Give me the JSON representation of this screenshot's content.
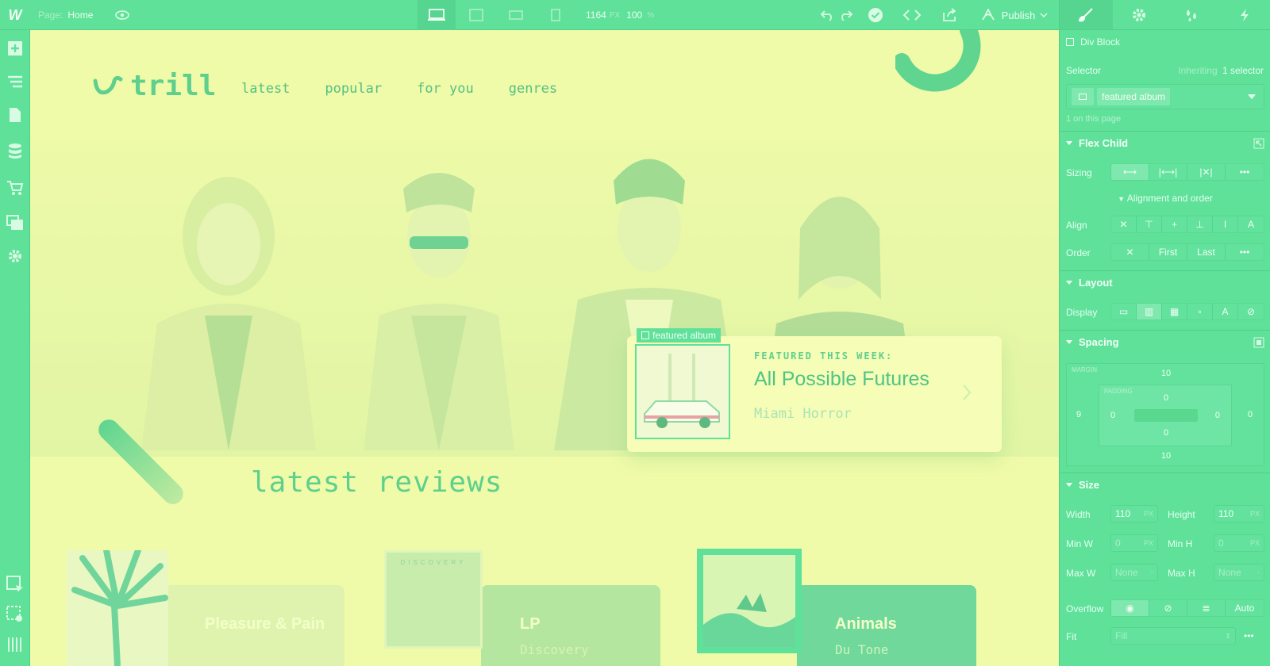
{
  "topbar": {
    "logo": "W",
    "page_label": "Page:",
    "page_name": "Home",
    "width_value": "1164",
    "width_unit": "PX",
    "zoom_value": "100",
    "zoom_unit": "%",
    "publish_label": "Publish"
  },
  "site": {
    "brand": "trill",
    "nav": [
      "latest",
      "popular",
      "for you",
      "genres"
    ],
    "featured_tag": "featured album",
    "featured_kicker": "FEATURED THIS WEEK:",
    "featured_title": "All Possible Futures",
    "featured_artist": "Miami Horror",
    "reviews_title": "latest reviews",
    "cards": [
      {
        "title": "Pleasure & Pain"
      },
      {
        "title": "LP",
        "subtitle": "Discovery",
        "cover_text": "DISCOVERY"
      },
      {
        "title": "Animals",
        "subtitle": "Du Tone"
      }
    ]
  },
  "panel": {
    "element_name": "Div Block",
    "selector_label": "Selector",
    "inheriting_label": "Inheriting",
    "inheriting_count": "1 selector",
    "selector_value": "featured album",
    "on_page_text": "1 on this page",
    "flex_child_title": "Flex Child",
    "sizing_label": "Sizing",
    "alignment_order_label": "Alignment and order",
    "align_label": "Align",
    "order_label": "Order",
    "order_first": "First",
    "order_last": "Last",
    "layout_title": "Layout",
    "display_label": "Display",
    "spacing_title": "Spacing",
    "margin_label": "MARGIN",
    "padding_label": "PADDING",
    "margin_top": "10",
    "margin_bottom": "10",
    "margin_left": "9",
    "margin_right": "0",
    "padding_top": "0",
    "padding_bottom": "0",
    "padding_left": "0",
    "padding_right": "0",
    "size_title": "Size",
    "width_label": "Width",
    "width_value": "110",
    "height_label": "Height",
    "height_value": "110",
    "unit_px": "PX",
    "minw_label": "Min W",
    "minw_value": "0",
    "minh_label": "Min H",
    "minh_value": "0",
    "maxw_label": "Max W",
    "maxw_value": "None",
    "maxh_label": "Max H",
    "maxh_value": "None",
    "dash": "-",
    "overflow_label": "Overflow",
    "overflow_auto": "Auto",
    "fit_label": "Fit",
    "fit_value": "Fill"
  },
  "colors": {
    "chrome": "#5fe19a",
    "canvas": "#f0fba9",
    "accent_text": "#5fcf8d"
  }
}
